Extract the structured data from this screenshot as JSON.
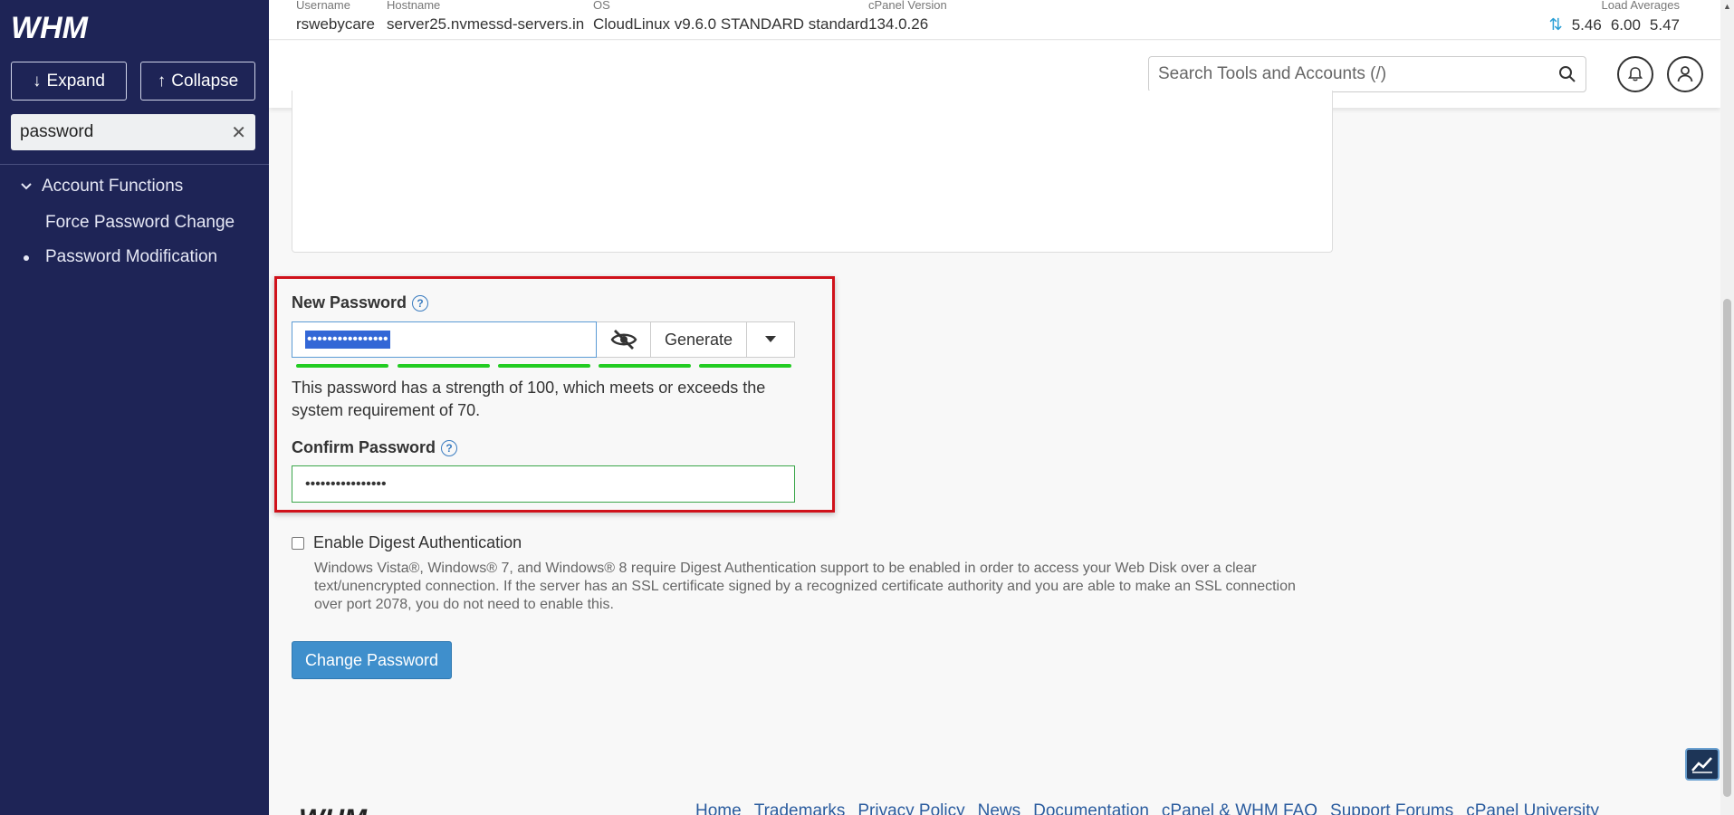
{
  "sidebar": {
    "logo_text": "WHM",
    "expand_label": "Expand",
    "collapse_label": "Collapse",
    "search_value": "password",
    "category": "Account Functions",
    "items": [
      {
        "label": "Force Password Change"
      },
      {
        "label": "Password Modification"
      }
    ]
  },
  "topbar": {
    "username_label": "Username",
    "username": "rswebycare",
    "hostname_label": "Hostname",
    "hostname": "server25.nvmessd-servers.in",
    "os_label": "OS",
    "os": "CloudLinux v9.6.0 STANDARD standard",
    "cpanel_label": "cPanel Version",
    "cpanel": "134.0.26",
    "load_label": "Load Averages",
    "load": [
      "5.46",
      "6.00",
      "5.47"
    ]
  },
  "search": {
    "placeholder": "Search Tools and Accounts (/)"
  },
  "form": {
    "new_password_label": "New Password",
    "new_password_masked": "••••••••••••••••",
    "generate_label": "Generate",
    "strength_text": "This password has a strength of 100, which meets or exceeds the system requirement of 70.",
    "strength_segments": 5,
    "confirm_password_label": "Confirm Password",
    "confirm_password_masked": "••••••••••••••••",
    "digest_label": "Enable Digest Authentication",
    "digest_help": "Windows Vista®, Windows® 7, and Windows® 8 require Digest Authentication support to be enabled in order to access your Web Disk over a clear text/unencrypted connection. If the server has an SSL certificate signed by a recognized certificate authority and you are able to make an SSL connection over port 2078, you do not need to enable this.",
    "submit_label": "Change Password"
  },
  "footer": {
    "links": [
      "Home",
      "Trademarks",
      "Privacy Policy",
      "News",
      "Documentation",
      "cPanel & WHM FAQ",
      "Support Forums",
      "cPanel University"
    ]
  },
  "colors": {
    "sidebar_bg": "#1e2456",
    "highlight": "#d0121b",
    "strength": "#22cc22",
    "primary_button": "#3f8fcc"
  }
}
